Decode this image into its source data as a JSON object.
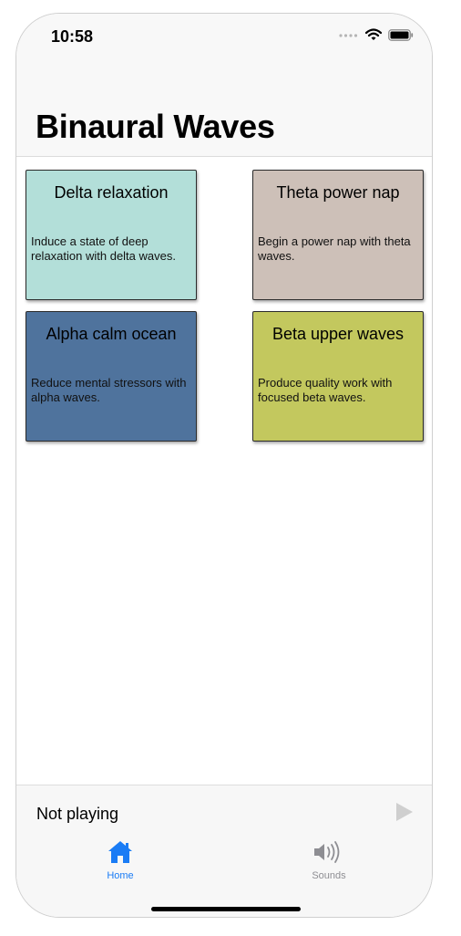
{
  "status_bar": {
    "time": "10:58"
  },
  "header": {
    "title": "Binaural Waves"
  },
  "cards": [
    {
      "title": "Delta relaxation",
      "description": "Induce a state of deep relaxation with delta waves.",
      "color": "#b3dfd9"
    },
    {
      "title": "Theta power nap",
      "description": "Begin a power nap with theta waves.",
      "color": "#cdc0b8"
    },
    {
      "title": "Alpha calm ocean",
      "description": "Reduce mental stressors with alpha waves.",
      "color": "#4f739d"
    },
    {
      "title": "Beta upper waves",
      "description": "Produce quality work with focused beta waves.",
      "color": "#c3c85e"
    }
  ],
  "player": {
    "status": "Not playing",
    "play_icon": "play-icon"
  },
  "tabs": [
    {
      "label": "Home",
      "icon": "home-icon",
      "active": true
    },
    {
      "label": "Sounds",
      "icon": "speaker-icon",
      "active": false
    }
  ],
  "colors": {
    "accent": "#1a7cf5",
    "inactive": "#8e8e93"
  }
}
